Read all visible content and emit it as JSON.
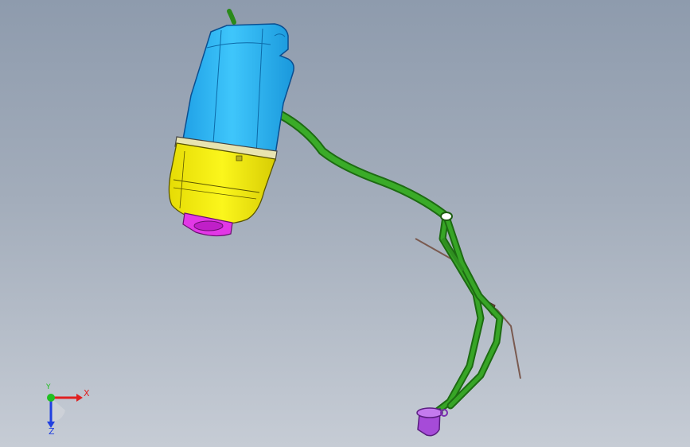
{
  "scene": {
    "title": "",
    "colors": {
      "background_top": "#8e9bad",
      "background_bottom": "#c6ccd5",
      "reservoir_upper": "#1fb6f2",
      "reservoir_lower": "#f4ee0e",
      "cap": "#e238e6",
      "hose": "#2e9b1e",
      "connector": "#a64bd8",
      "bracket": "#8a6a5a"
    }
  },
  "triad": {
    "x_label": "X",
    "y_label": "Y",
    "z_label": "Z",
    "x_color": "#e02020",
    "y_color": "#20c020",
    "z_color": "#2040e0"
  }
}
